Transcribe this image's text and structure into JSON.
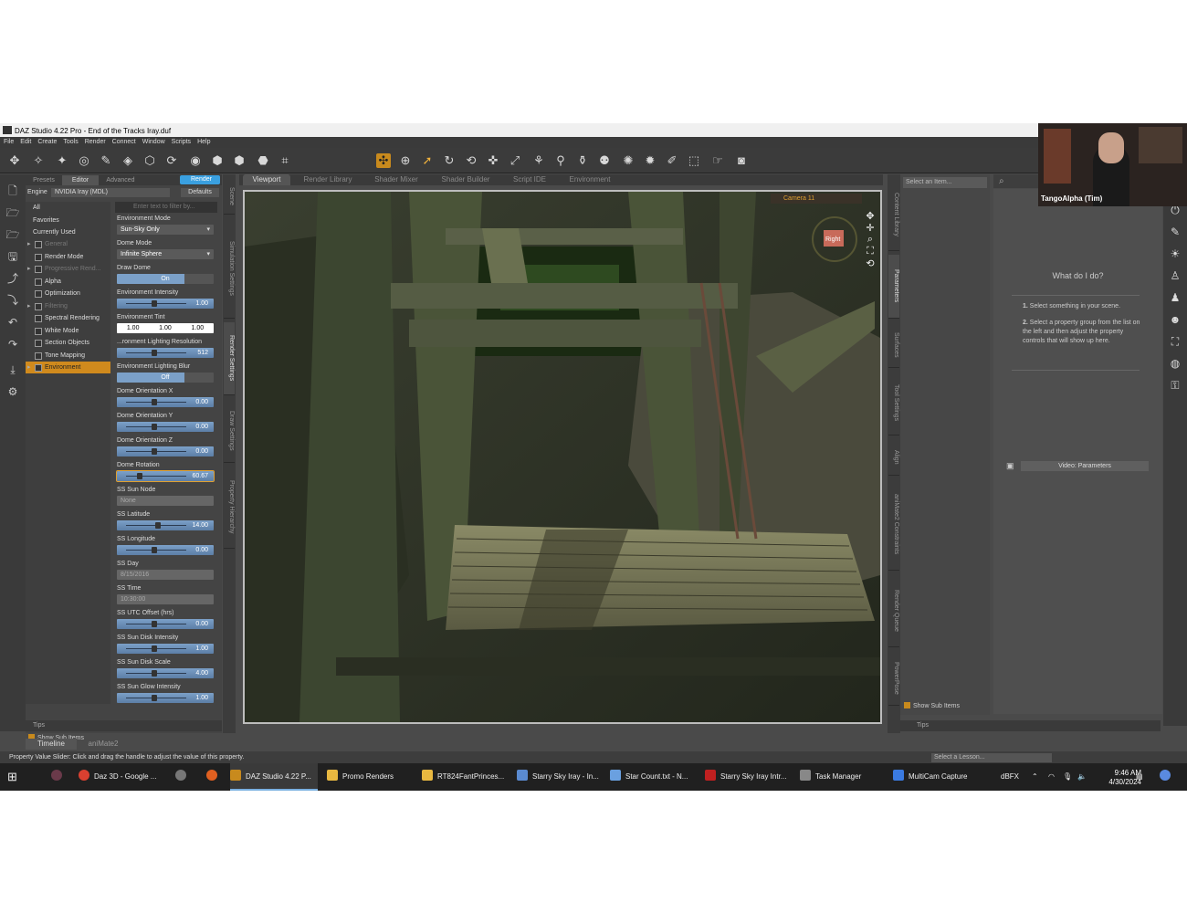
{
  "window": {
    "title": "DAZ Studio 4.22 Pro - End of the Tracks Iray.duf"
  },
  "menu": [
    "File",
    "Edit",
    "Create",
    "Tools",
    "Render",
    "Connect",
    "Window",
    "Scripts",
    "Help"
  ],
  "render_panel": {
    "tabs": [
      "Presets",
      "Editor",
      "Advanced"
    ],
    "render_button": "Render",
    "engine_label": "Engine",
    "engine_value": "NVIDIA Iray (MDL)",
    "defaults": "Defaults",
    "filter_placeholder": "Enter text to filter by...",
    "categories": [
      {
        "label": "All"
      },
      {
        "label": "Favorites"
      },
      {
        "label": "Currently Used"
      },
      {
        "label": "General"
      },
      {
        "label": "Render Mode"
      },
      {
        "label": "Progressive Rend..."
      },
      {
        "label": "Alpha"
      },
      {
        "label": "Optimization"
      },
      {
        "label": "Filtering"
      },
      {
        "label": "Spectral Rendering"
      },
      {
        "label": "White Mode"
      },
      {
        "label": "Section Objects"
      },
      {
        "label": "Tone Mapping"
      },
      {
        "label": "Environment"
      }
    ],
    "show_sub_items": "Show Sub Items",
    "properties": [
      {
        "label": "Environment Mode",
        "value": "Sun-Sky Only"
      },
      {
        "label": "Dome Mode",
        "value": "Infinite Sphere"
      },
      {
        "label": "Draw Dome",
        "value": "On"
      },
      {
        "label": "Environment Intensity",
        "value": "1.00"
      },
      {
        "label": "Environment Tint",
        "v1": "1.00",
        "v2": "1.00",
        "v3": "1.00"
      },
      {
        "label": "...ronment Lighting Resolution",
        "value": "512"
      },
      {
        "label": "Environment Lighting Blur",
        "value": "Off"
      },
      {
        "label": "Dome Orientation X",
        "value": "0.00"
      },
      {
        "label": "Dome Orientation Y",
        "value": "0.00"
      },
      {
        "label": "Dome Orientation Z",
        "value": "0.00"
      },
      {
        "label": "Dome Rotation",
        "value": "60.67"
      },
      {
        "label": "SS Sun Node",
        "value": "None"
      },
      {
        "label": "SS Latitude",
        "value": "14.00"
      },
      {
        "label": "SS Longitude",
        "value": "0.00"
      },
      {
        "label": "SS Day",
        "value": "8/15/2016"
      },
      {
        "label": "SS Time",
        "value": "10:30:00"
      },
      {
        "label": "SS UTC Offset (hrs)",
        "value": "0.00"
      },
      {
        "label": "SS Sun Disk Intensity",
        "value": "1.00"
      },
      {
        "label": "SS Sun Disk Scale",
        "value": "4.00"
      },
      {
        "label": "SS Sun Glow Intensity",
        "value": "1.00"
      }
    ],
    "tips": "Tips"
  },
  "left_vtabs": [
    "Scene",
    "Simulation Settings",
    "Render Settings",
    "Draw Settings",
    "Property Hierarchy"
  ],
  "viewport": {
    "tabs": [
      "Viewport",
      "Render Library",
      "Shader Mixer",
      "Shader Builder",
      "Script IDE",
      "Environment"
    ],
    "camera": "Camera 11",
    "gizmo_label": "Right"
  },
  "right_vtabs": [
    "Content Library",
    "Parameters",
    "Surfaces",
    "Tool Settings",
    "Align",
    "aniMate2 Constraints",
    "Render Queue",
    "PowerPose"
  ],
  "parameters": {
    "select_item": "Select an Item...",
    "show_sub_items": "Show Sub Items",
    "tips": "Tips"
  },
  "help": {
    "title": "What do I do?",
    "step1_num": "1.",
    "step1": "Select something in your scene.",
    "step2_num": "2.",
    "step2": "Select a property group from the list on the left and then adjust the property controls that will show up here.",
    "video": "Video: Parameters"
  },
  "timeline": {
    "tabs": [
      "Timeline",
      "aniMate2"
    ]
  },
  "status": {
    "text": "Property Value Slider: Click and drag the handle to adjust the value of this property.",
    "lesson": "Select a Lesson..."
  },
  "webcam": {
    "name": "TangoAlpha (Tim)"
  },
  "taskbar": {
    "items": [
      "Daz 3D - Google ...",
      "DAZ Studio 4.22 P...",
      "Promo Renders",
      "RT824FantPrinces...",
      "Starry Sky Iray - In...",
      "Star Count.txt - N...",
      "Starry Sky Iray Intr...",
      "Task Manager",
      "MultiCam Capture"
    ],
    "tray": "dBFX",
    "time": "9:46 AM",
    "date": "4/30/2024"
  }
}
